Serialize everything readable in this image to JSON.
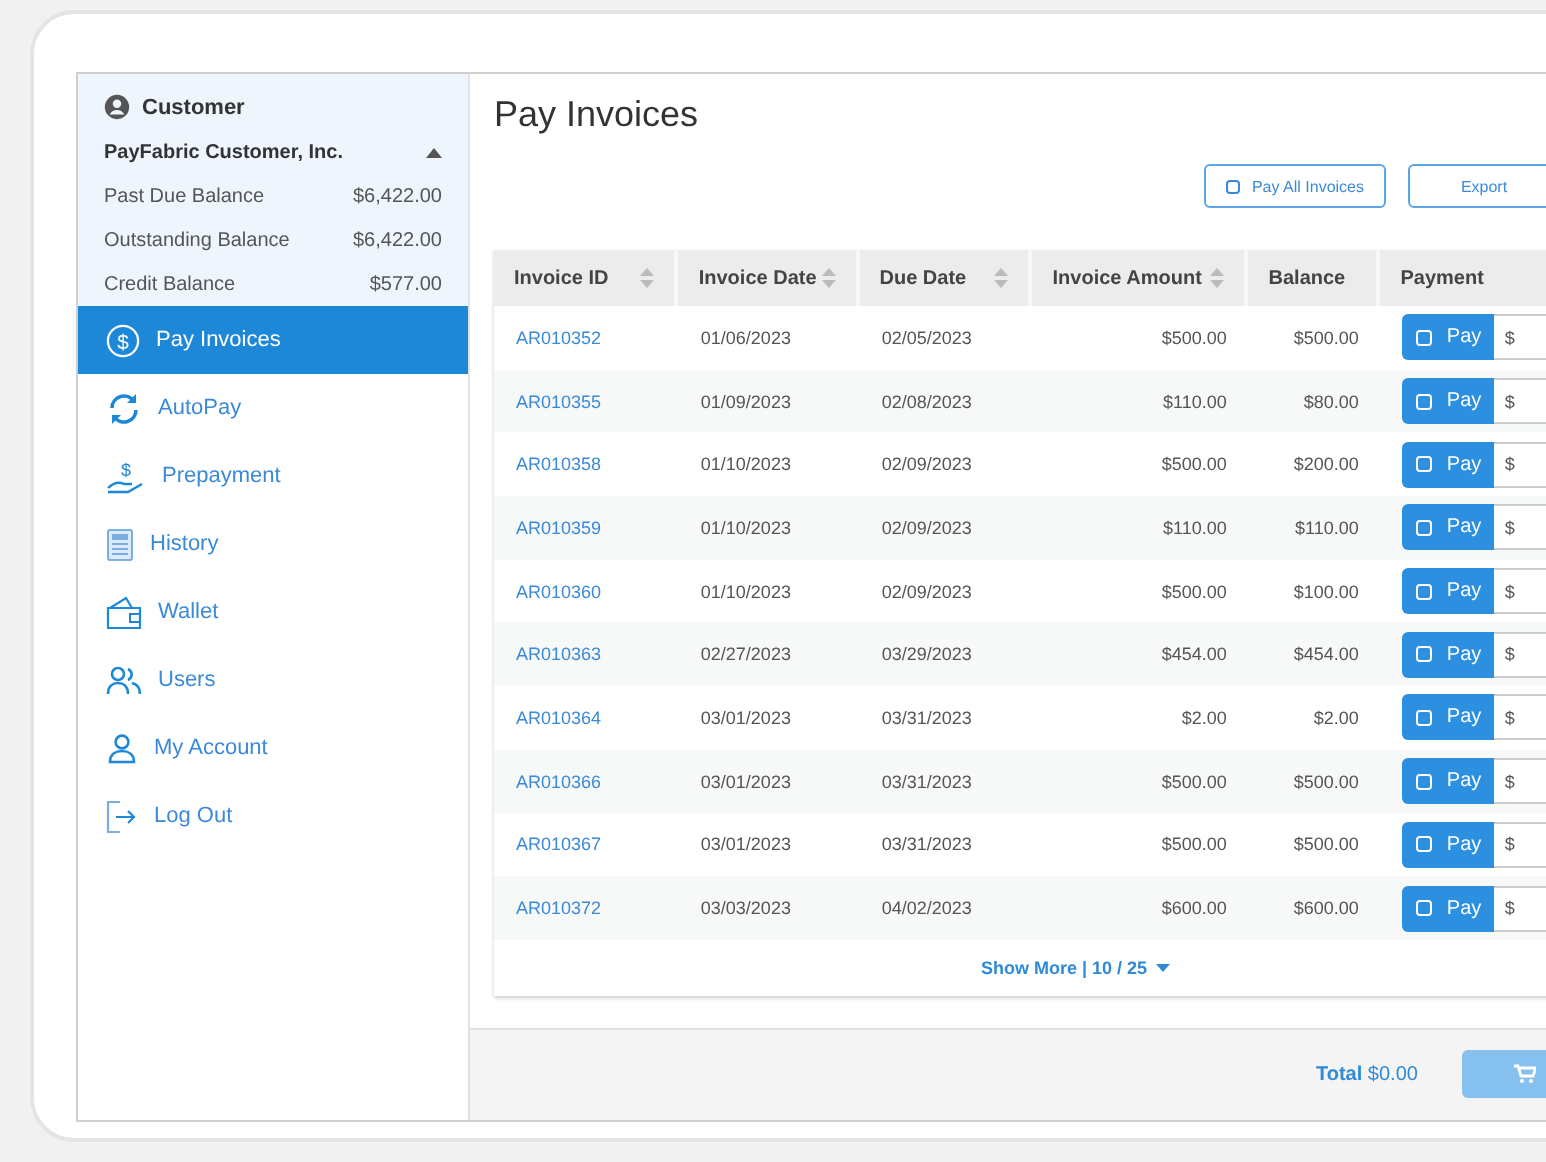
{
  "sidebar": {
    "customer_label": "Customer",
    "account": {
      "name": "PayFabric Customer, Inc.",
      "expanded": true,
      "balances": [
        {
          "label": "Past Due Balance",
          "value": "$6,422.00"
        },
        {
          "label": "Outstanding Balance",
          "value": "$6,422.00"
        },
        {
          "label": "Credit Balance",
          "value": "$577.00"
        }
      ]
    },
    "items": [
      {
        "kind": "dollar",
        "icon_text": "$",
        "label": "Pay Invoices",
        "selected": true
      },
      {
        "kind": "refresh",
        "label": "AutoPay",
        "selected": false
      },
      {
        "kind": "hand",
        "icon_text": "$",
        "label": "Prepayment",
        "selected": false
      },
      {
        "kind": "calculator",
        "label": "History",
        "selected": false
      },
      {
        "kind": "wallet",
        "label": "Wallet",
        "selected": false
      },
      {
        "kind": "users",
        "label": "Users",
        "selected": false
      },
      {
        "kind": "user",
        "label": "My Account",
        "selected": false
      },
      {
        "kind": "logout",
        "label": "Log Out",
        "selected": false
      }
    ]
  },
  "page_title": "Pay Invoices",
  "toolbar": {
    "pay_all": {
      "label": "Pay All Invoices",
      "checked": false
    },
    "export": "Export"
  },
  "table": {
    "columns": [
      {
        "label": "Invoice ID",
        "sortable": true
      },
      {
        "label": "Invoice Date",
        "sortable": true
      },
      {
        "label": "Due Date",
        "sortable": true
      },
      {
        "label": "Invoice Amount",
        "sortable": true
      },
      {
        "label": "Balance",
        "sortable": false
      },
      {
        "label": "Payment",
        "sortable": false
      }
    ],
    "rows": [
      {
        "id": "AR010352",
        "invoice_date": "01/06/2023",
        "due_date": "02/05/2023",
        "amount": "$500.00",
        "balance": "$500.00",
        "pay_label": "Pay",
        "checked": false,
        "currency": "$"
      },
      {
        "id": "AR010355",
        "invoice_date": "01/09/2023",
        "due_date": "02/08/2023",
        "amount": "$110.00",
        "balance": "$80.00",
        "pay_label": "Pay",
        "checked": false,
        "currency": "$"
      },
      {
        "id": "AR010358",
        "invoice_date": "01/10/2023",
        "due_date": "02/09/2023",
        "amount": "$500.00",
        "balance": "$200.00",
        "pay_label": "Pay",
        "checked": false,
        "currency": "$"
      },
      {
        "id": "AR010359",
        "invoice_date": "01/10/2023",
        "due_date": "02/09/2023",
        "amount": "$110.00",
        "balance": "$110.00",
        "pay_label": "Pay",
        "checked": false,
        "currency": "$"
      },
      {
        "id": "AR010360",
        "invoice_date": "01/10/2023",
        "due_date": "02/09/2023",
        "amount": "$500.00",
        "balance": "$100.00",
        "pay_label": "Pay",
        "checked": false,
        "currency": "$"
      },
      {
        "id": "AR010363",
        "invoice_date": "02/27/2023",
        "due_date": "03/29/2023",
        "amount": "$454.00",
        "balance": "$454.00",
        "pay_label": "Pay",
        "checked": false,
        "currency": "$"
      },
      {
        "id": "AR010364",
        "invoice_date": "03/01/2023",
        "due_date": "03/31/2023",
        "amount": "$2.00",
        "balance": "$2.00",
        "pay_label": "Pay",
        "checked": false,
        "currency": "$"
      },
      {
        "id": "AR010366",
        "invoice_date": "03/01/2023",
        "due_date": "03/31/2023",
        "amount": "$500.00",
        "balance": "$500.00",
        "pay_label": "Pay",
        "checked": false,
        "currency": "$"
      },
      {
        "id": "AR010367",
        "invoice_date": "03/01/2023",
        "due_date": "03/31/2023",
        "amount": "$500.00",
        "balance": "$500.00",
        "pay_label": "Pay",
        "checked": false,
        "currency": "$"
      },
      {
        "id": "AR010372",
        "invoice_date": "03/03/2023",
        "due_date": "04/02/2023",
        "amount": "$600.00",
        "balance": "$600.00",
        "pay_label": "Pay",
        "checked": false,
        "currency": "$"
      }
    ],
    "show_more": "Show More | 10 / 25"
  },
  "footer": {
    "total_label": "Total",
    "total_value": "$0.00"
  }
}
